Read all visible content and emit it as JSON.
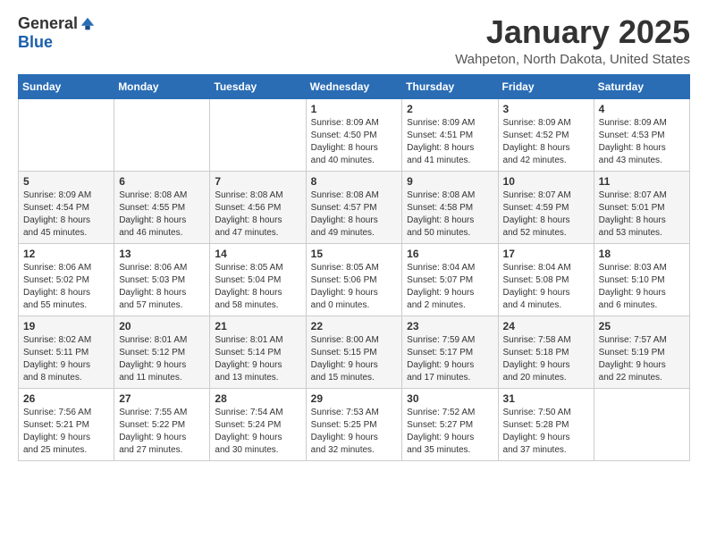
{
  "logo": {
    "general": "General",
    "blue": "Blue"
  },
  "header": {
    "month": "January 2025",
    "location": "Wahpeton, North Dakota, United States"
  },
  "weekdays": [
    "Sunday",
    "Monday",
    "Tuesday",
    "Wednesday",
    "Thursday",
    "Friday",
    "Saturday"
  ],
  "weeks": [
    [
      {
        "day": "",
        "info": ""
      },
      {
        "day": "",
        "info": ""
      },
      {
        "day": "",
        "info": ""
      },
      {
        "day": "1",
        "info": "Sunrise: 8:09 AM\nSunset: 4:50 PM\nDaylight: 8 hours\nand 40 minutes."
      },
      {
        "day": "2",
        "info": "Sunrise: 8:09 AM\nSunset: 4:51 PM\nDaylight: 8 hours\nand 41 minutes."
      },
      {
        "day": "3",
        "info": "Sunrise: 8:09 AM\nSunset: 4:52 PM\nDaylight: 8 hours\nand 42 minutes."
      },
      {
        "day": "4",
        "info": "Sunrise: 8:09 AM\nSunset: 4:53 PM\nDaylight: 8 hours\nand 43 minutes."
      }
    ],
    [
      {
        "day": "5",
        "info": "Sunrise: 8:09 AM\nSunset: 4:54 PM\nDaylight: 8 hours\nand 45 minutes."
      },
      {
        "day": "6",
        "info": "Sunrise: 8:08 AM\nSunset: 4:55 PM\nDaylight: 8 hours\nand 46 minutes."
      },
      {
        "day": "7",
        "info": "Sunrise: 8:08 AM\nSunset: 4:56 PM\nDaylight: 8 hours\nand 47 minutes."
      },
      {
        "day": "8",
        "info": "Sunrise: 8:08 AM\nSunset: 4:57 PM\nDaylight: 8 hours\nand 49 minutes."
      },
      {
        "day": "9",
        "info": "Sunrise: 8:08 AM\nSunset: 4:58 PM\nDaylight: 8 hours\nand 50 minutes."
      },
      {
        "day": "10",
        "info": "Sunrise: 8:07 AM\nSunset: 4:59 PM\nDaylight: 8 hours\nand 52 minutes."
      },
      {
        "day": "11",
        "info": "Sunrise: 8:07 AM\nSunset: 5:01 PM\nDaylight: 8 hours\nand 53 minutes."
      }
    ],
    [
      {
        "day": "12",
        "info": "Sunrise: 8:06 AM\nSunset: 5:02 PM\nDaylight: 8 hours\nand 55 minutes."
      },
      {
        "day": "13",
        "info": "Sunrise: 8:06 AM\nSunset: 5:03 PM\nDaylight: 8 hours\nand 57 minutes."
      },
      {
        "day": "14",
        "info": "Sunrise: 8:05 AM\nSunset: 5:04 PM\nDaylight: 8 hours\nand 58 minutes."
      },
      {
        "day": "15",
        "info": "Sunrise: 8:05 AM\nSunset: 5:06 PM\nDaylight: 9 hours\nand 0 minutes."
      },
      {
        "day": "16",
        "info": "Sunrise: 8:04 AM\nSunset: 5:07 PM\nDaylight: 9 hours\nand 2 minutes."
      },
      {
        "day": "17",
        "info": "Sunrise: 8:04 AM\nSunset: 5:08 PM\nDaylight: 9 hours\nand 4 minutes."
      },
      {
        "day": "18",
        "info": "Sunrise: 8:03 AM\nSunset: 5:10 PM\nDaylight: 9 hours\nand 6 minutes."
      }
    ],
    [
      {
        "day": "19",
        "info": "Sunrise: 8:02 AM\nSunset: 5:11 PM\nDaylight: 9 hours\nand 8 minutes."
      },
      {
        "day": "20",
        "info": "Sunrise: 8:01 AM\nSunset: 5:12 PM\nDaylight: 9 hours\nand 11 minutes."
      },
      {
        "day": "21",
        "info": "Sunrise: 8:01 AM\nSunset: 5:14 PM\nDaylight: 9 hours\nand 13 minutes."
      },
      {
        "day": "22",
        "info": "Sunrise: 8:00 AM\nSunset: 5:15 PM\nDaylight: 9 hours\nand 15 minutes."
      },
      {
        "day": "23",
        "info": "Sunrise: 7:59 AM\nSunset: 5:17 PM\nDaylight: 9 hours\nand 17 minutes."
      },
      {
        "day": "24",
        "info": "Sunrise: 7:58 AM\nSunset: 5:18 PM\nDaylight: 9 hours\nand 20 minutes."
      },
      {
        "day": "25",
        "info": "Sunrise: 7:57 AM\nSunset: 5:19 PM\nDaylight: 9 hours\nand 22 minutes."
      }
    ],
    [
      {
        "day": "26",
        "info": "Sunrise: 7:56 AM\nSunset: 5:21 PM\nDaylight: 9 hours\nand 25 minutes."
      },
      {
        "day": "27",
        "info": "Sunrise: 7:55 AM\nSunset: 5:22 PM\nDaylight: 9 hours\nand 27 minutes."
      },
      {
        "day": "28",
        "info": "Sunrise: 7:54 AM\nSunset: 5:24 PM\nDaylight: 9 hours\nand 30 minutes."
      },
      {
        "day": "29",
        "info": "Sunrise: 7:53 AM\nSunset: 5:25 PM\nDaylight: 9 hours\nand 32 minutes."
      },
      {
        "day": "30",
        "info": "Sunrise: 7:52 AM\nSunset: 5:27 PM\nDaylight: 9 hours\nand 35 minutes."
      },
      {
        "day": "31",
        "info": "Sunrise: 7:50 AM\nSunset: 5:28 PM\nDaylight: 9 hours\nand 37 minutes."
      },
      {
        "day": "",
        "info": ""
      }
    ]
  ]
}
